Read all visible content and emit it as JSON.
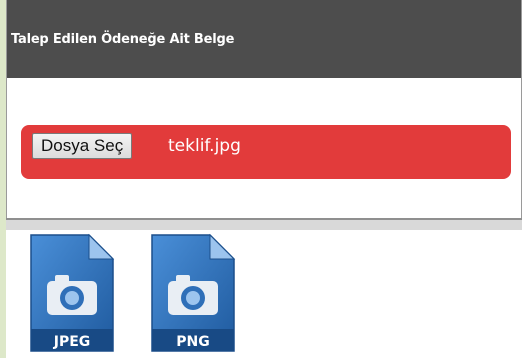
{
  "panel": {
    "title": "Talep Edilen Ödeneğe Ait Belge"
  },
  "upload": {
    "button_label": "Dosya Seç",
    "file_name": "teklif.jpg",
    "bar_color": "#e23b3b"
  },
  "file_types": [
    {
      "label": "JPEG",
      "icon": "jpeg-file-icon"
    },
    {
      "label": "PNG",
      "icon": "png-file-icon"
    }
  ],
  "colors": {
    "header_bg": "#4d4d4d",
    "icon_blue": "#2f6fb8"
  }
}
